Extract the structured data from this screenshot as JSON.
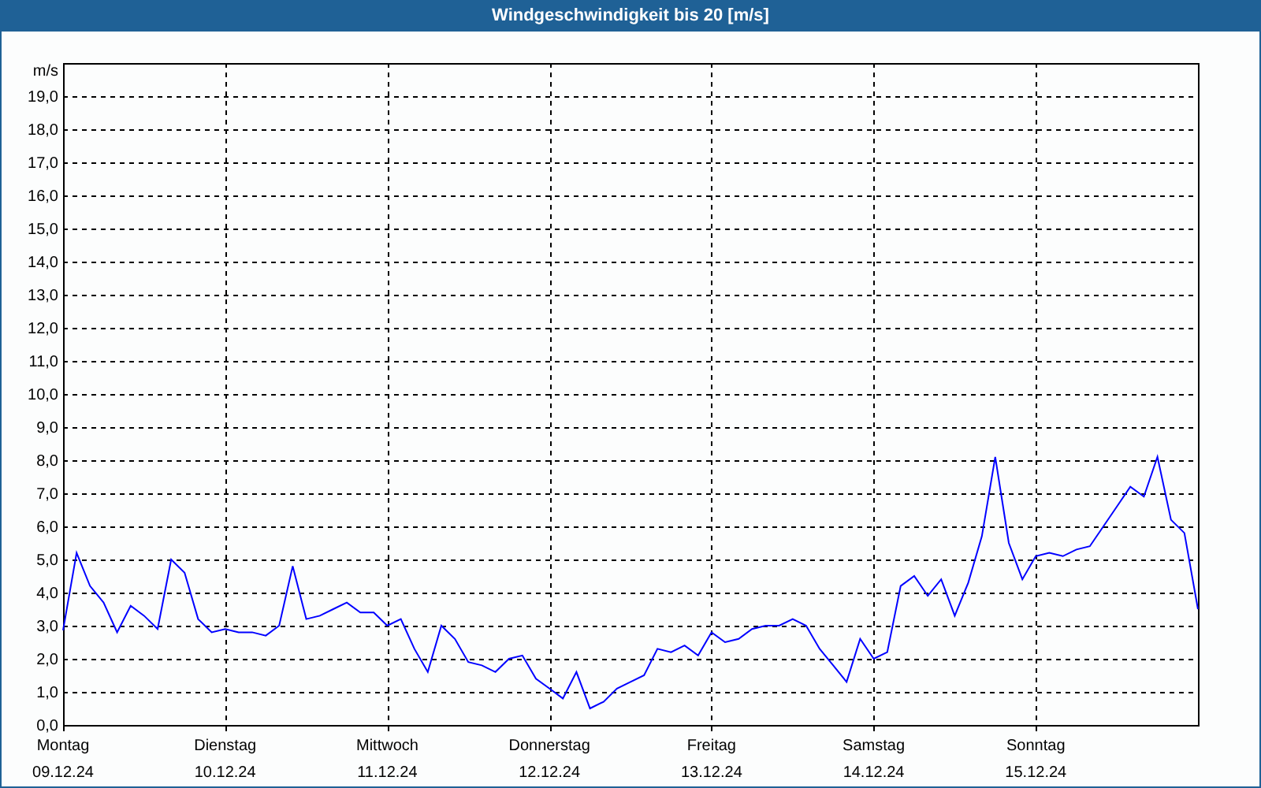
{
  "window": {
    "title": "Windgeschwindigkeit bis 20 [m/s]"
  },
  "chart": {
    "chart_data": {
      "type": "line",
      "ylabel": "m/s",
      "categories": [
        "09.12.24",
        null,
        null,
        null,
        null,
        null,
        null,
        null,
        null,
        null,
        null,
        null,
        "10.12.24",
        null,
        null,
        null,
        null,
        null,
        null,
        null,
        null,
        null,
        null,
        null,
        "11.12.24",
        null,
        null,
        null,
        null,
        null,
        null,
        null,
        null,
        null,
        null,
        null,
        "12.12.24",
        null,
        null,
        null,
        null,
        null,
        null,
        null,
        null,
        null,
        null,
        null,
        "13.12.24",
        null,
        null,
        null,
        null,
        null,
        null,
        null,
        null,
        null,
        null,
        null,
        "14.12.24",
        null,
        null,
        null,
        null,
        null,
        null,
        null,
        null,
        null,
        null,
        null,
        "15.12.24",
        null,
        null,
        null,
        null,
        null,
        null,
        null,
        null,
        null,
        null,
        null,
        null
      ],
      "series": [
        {
          "color": "#0000ff",
          "values": [
            2.86,
            5.2,
            4.2,
            3.7,
            2.8,
            3.6,
            3.3,
            2.9,
            5.0,
            4.6,
            3.2,
            2.8,
            2.9,
            2.8,
            2.8,
            2.7,
            3.0,
            4.8,
            3.2,
            3.3,
            3.5,
            3.7,
            3.4,
            3.4,
            3.0,
            3.2,
            2.3,
            1.6,
            3.0,
            2.6,
            1.9,
            1.8,
            1.6,
            2.0,
            2.1,
            1.4,
            1.1,
            0.8,
            1.6,
            0.5,
            0.7,
            1.1,
            1.3,
            1.5,
            2.3,
            2.2,
            2.4,
            2.1,
            2.8,
            2.5,
            2.6,
            2.9,
            3.0,
            3.0,
            3.2,
            3.0,
            2.3,
            1.8,
            1.3,
            2.6,
            2.0,
            2.2,
            4.2,
            4.5,
            3.9,
            4.4,
            3.3,
            4.3,
            5.7,
            8.1,
            5.5,
            4.4,
            5.1,
            5.2,
            5.1,
            5.3,
            5.4,
            6.0,
            6.6,
            7.2,
            6.9,
            8.1,
            6.2,
            5.8,
            3.5
          ]
        }
      ],
      "ylim": [
        0,
        20
      ],
      "grid": true,
      "yticks": [
        {
          "value": 0,
          "label": "0,0"
        },
        {
          "value": 1,
          "label": "1,0"
        },
        {
          "value": 2,
          "label": "2,0"
        },
        {
          "value": 3,
          "label": "3,0"
        },
        {
          "value": 4,
          "label": "4,0"
        },
        {
          "value": 5,
          "label": "5,0"
        },
        {
          "value": 6,
          "label": "6,0"
        },
        {
          "value": 7,
          "label": "7,0"
        },
        {
          "value": 8,
          "label": "8,0"
        },
        {
          "value": 9,
          "label": "9,0"
        },
        {
          "value": 10,
          "label": "10,0"
        },
        {
          "value": 11,
          "label": "11,0"
        },
        {
          "value": 12,
          "label": "12,0"
        },
        {
          "value": 13,
          "label": "13,0"
        },
        {
          "value": 14,
          "label": "14,0"
        },
        {
          "value": 15,
          "label": "15,0"
        },
        {
          "value": 16,
          "label": "16,0"
        },
        {
          "value": 17,
          "label": "17,0"
        },
        {
          "value": 18,
          "label": "18,0"
        },
        {
          "value": 19,
          "label": "19,0"
        }
      ]
    },
    "tick_weekdays": [
      "Montag",
      "Dienstag",
      "Mittwoch",
      "Donnerstag",
      "Freitag",
      "Samstag",
      "Sonntag"
    ]
  }
}
